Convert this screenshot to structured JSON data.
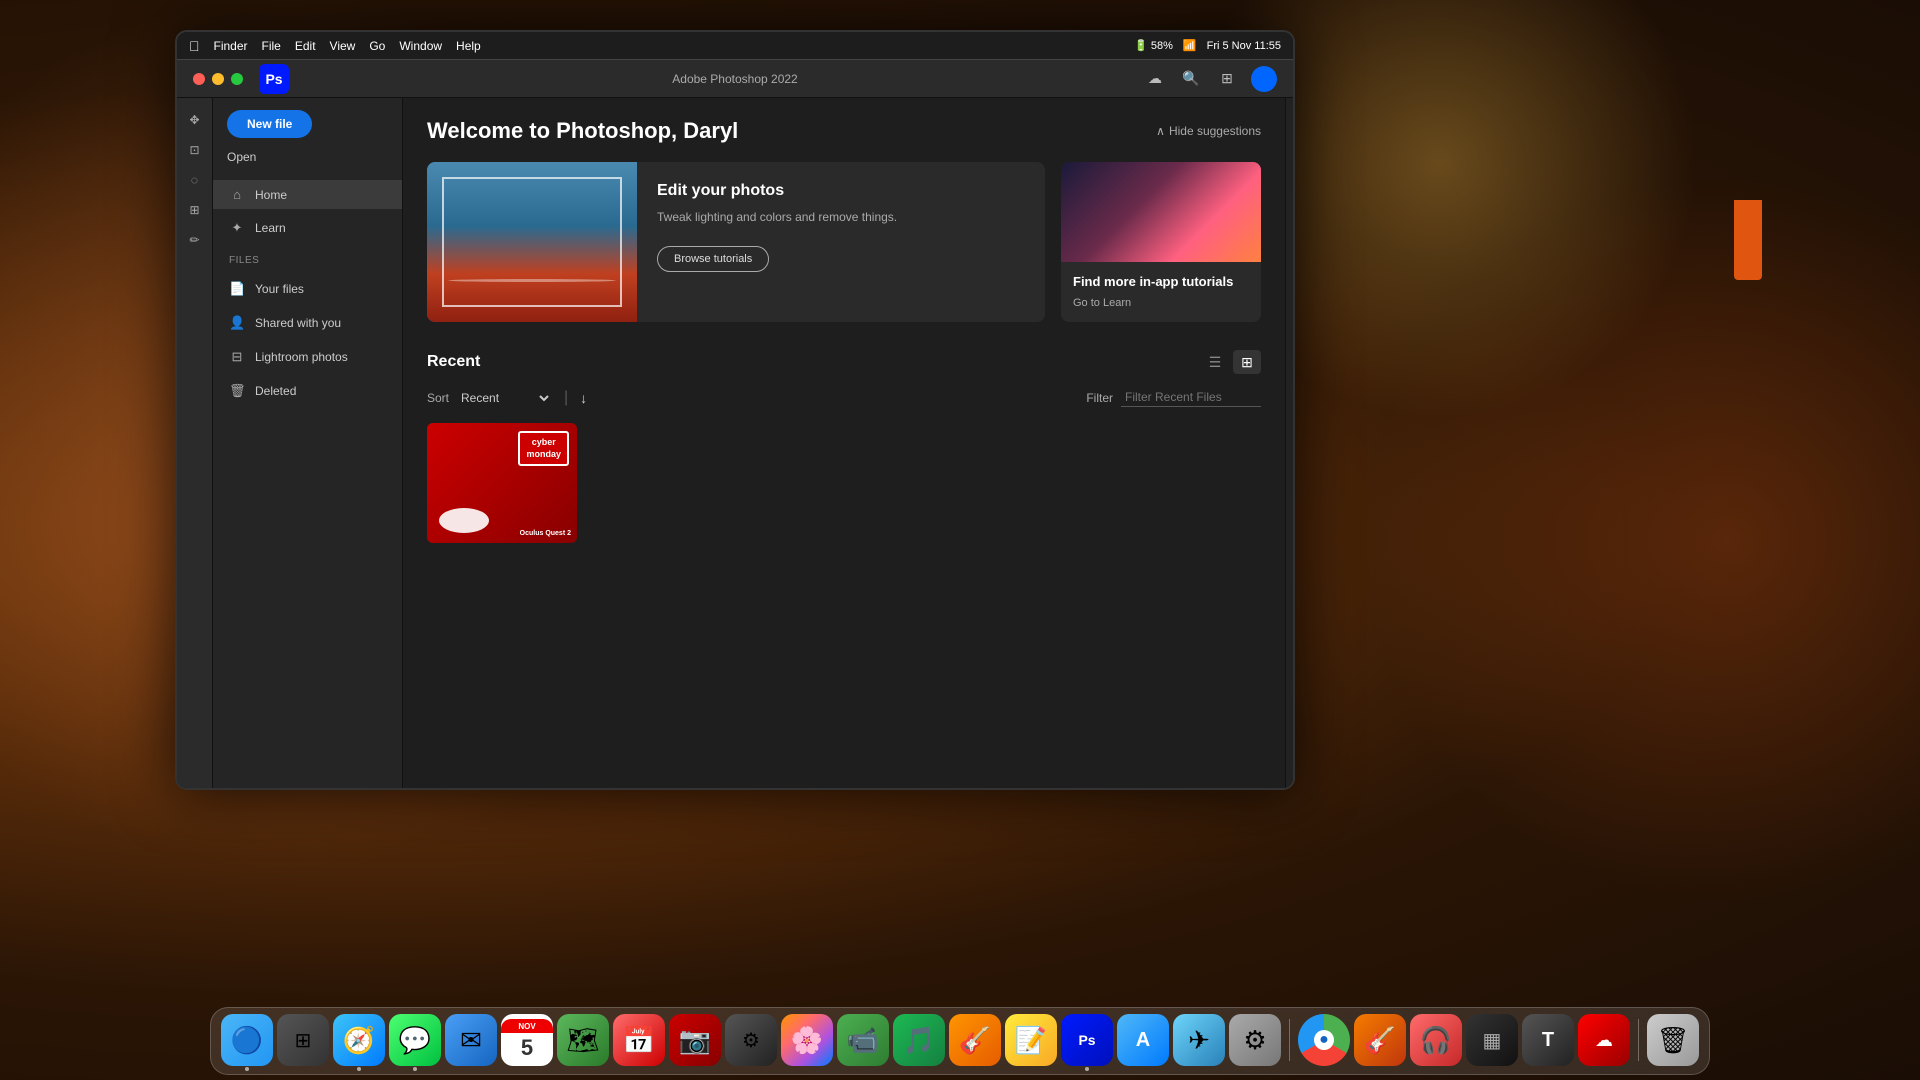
{
  "macos": {
    "menubar": {
      "apple": "⌘",
      "items": [
        "Finder",
        "File",
        "Edit",
        "View",
        "Go",
        "Window",
        "Help"
      ],
      "right_items": [
        "battery_icon",
        "wifi_icon",
        "datetime"
      ],
      "datetime": "Fri 5 Nov  11:55"
    },
    "window_title": "Adobe Photoshop 2022"
  },
  "ps_app": {
    "title": "Adobe Photoshop 2022",
    "icon_label": "Ps",
    "sidebar": {
      "new_file_label": "New file",
      "open_label": "Open",
      "nav_items": [
        {
          "icon": "🏠",
          "label": "Home",
          "active": true
        },
        {
          "icon": "✦",
          "label": "Learn",
          "active": false
        }
      ],
      "files_section": "FILES",
      "files_items": [
        {
          "icon": "📄",
          "label": "Your files"
        },
        {
          "icon": "👤",
          "label": "Shared with you"
        },
        {
          "icon": "⊞",
          "label": "Lightroom photos"
        },
        {
          "icon": "🗑",
          "label": "Deleted"
        }
      ]
    },
    "main": {
      "welcome_title": "Welcome to Photoshop, Daryl",
      "hide_suggestions_label": "Hide suggestions",
      "suggestions": [
        {
          "title": "Edit your photos",
          "description": "Tweak lighting and colors and remove things.",
          "button_label": "Browse tutorials"
        }
      ],
      "small_card": {
        "title": "Find more in-app tutorials",
        "link_label": "Go to Learn"
      },
      "recent_section_title": "Recent",
      "sort_label": "Sort",
      "sort_value": "Recent",
      "filter_label": "Filter",
      "filter_placeholder": "Filter Recent Files",
      "recent_files": [
        {
          "name": "Cyber Monday - Oculus Quest 2",
          "type": "psd"
        }
      ]
    }
  },
  "dock": {
    "apps": [
      {
        "name": "Finder",
        "class": "dock-finder",
        "icon": "🔍",
        "running": true
      },
      {
        "name": "Launchpad",
        "class": "dock-launchpad",
        "icon": "⊞",
        "running": false
      },
      {
        "name": "Safari",
        "class": "dock-safari",
        "icon": "🧭",
        "running": true
      },
      {
        "name": "Messages",
        "class": "dock-messages",
        "icon": "💬",
        "running": true
      },
      {
        "name": "Mail",
        "class": "dock-mail",
        "icon": "✉",
        "running": false
      },
      {
        "name": "Calendar",
        "class": "dock-calendar",
        "icon": "5",
        "running": false
      },
      {
        "name": "Maps",
        "class": "dock-maps",
        "icon": "🗺",
        "running": false
      },
      {
        "name": "Fantastical",
        "class": "dock-fantastical",
        "icon": "📅",
        "running": false
      },
      {
        "name": "CodeShot",
        "class": "dock-codeshot",
        "icon": "📸",
        "running": false
      },
      {
        "name": "Compressor",
        "class": "dock-compressor",
        "icon": "⚙",
        "running": false
      },
      {
        "name": "Photos",
        "class": "dock-photos",
        "icon": "🌸",
        "running": false
      },
      {
        "name": "FaceTime",
        "class": "dock-facetime",
        "icon": "📹",
        "running": false
      },
      {
        "name": "Spotify",
        "class": "dock-spotify",
        "icon": "♪",
        "running": false
      },
      {
        "name": "Capo",
        "class": "dock-capo",
        "icon": "🎵",
        "running": false
      },
      {
        "name": "Notes",
        "class": "dock-notes",
        "icon": "📝",
        "running": false
      },
      {
        "name": "Photoshop",
        "class": "dock-photoshop",
        "icon": "Ps",
        "running": true
      },
      {
        "name": "App Store",
        "class": "dock-appstore",
        "icon": "A",
        "running": false
      },
      {
        "name": "TestFlight",
        "class": "dock-testflight",
        "icon": "✈",
        "running": false
      },
      {
        "name": "System Preferences",
        "class": "dock-syspref",
        "icon": "⚙",
        "running": false
      },
      {
        "name": "Chrome",
        "class": "dock-chrome",
        "icon": "◉",
        "running": false
      },
      {
        "name": "GarageBand",
        "class": "dock-garageband",
        "icon": "🎸",
        "running": false
      },
      {
        "name": "Headphones",
        "class": "dock-headphones",
        "icon": "🎧",
        "running": false
      },
      {
        "name": "ScreenSnap",
        "class": "dock-screensnap",
        "icon": "▦",
        "running": false
      },
      {
        "name": "Suitcase",
        "class": "dock-suitcase",
        "icon": "T",
        "running": false
      },
      {
        "name": "Creative Cloud",
        "class": "dock-creative-cloud",
        "icon": "☁",
        "running": false
      },
      {
        "name": "Trash",
        "class": "dock-trash",
        "icon": "🗑",
        "running": false
      }
    ]
  }
}
